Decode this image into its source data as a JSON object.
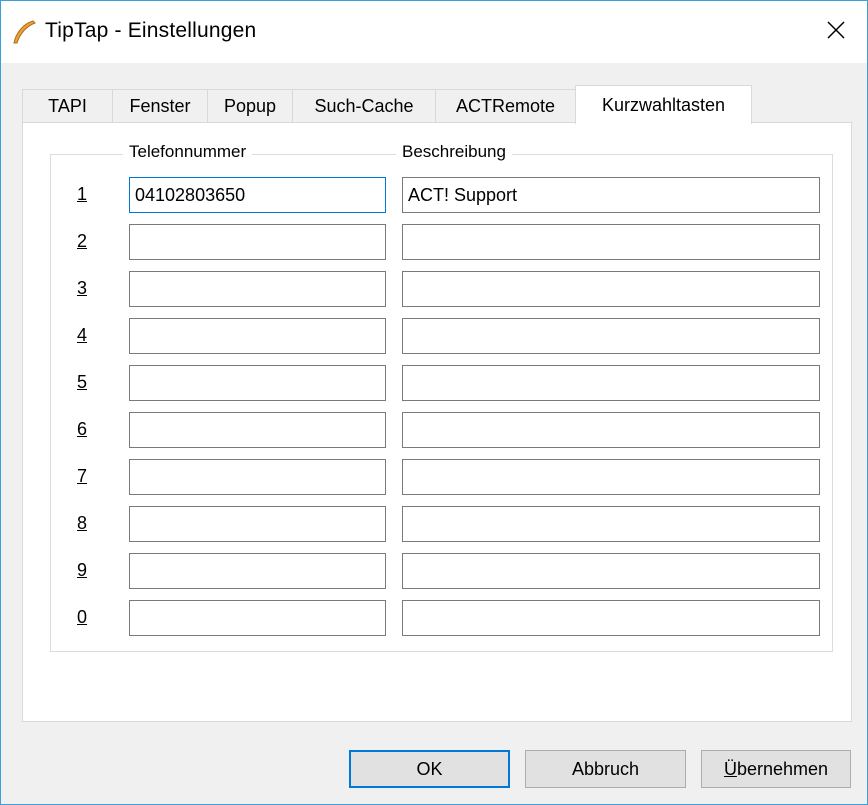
{
  "window": {
    "title": "TipTap - Einstellungen"
  },
  "tabs": [
    {
      "label": "TAPI",
      "active": false
    },
    {
      "label": "Fenster",
      "active": false
    },
    {
      "label": "Popup",
      "active": false
    },
    {
      "label": "Such-Cache",
      "active": false
    },
    {
      "label": "ACTRemote",
      "active": false
    },
    {
      "label": "Kurzwahltasten",
      "active": true
    }
  ],
  "speed_dial": {
    "phone_header": "Telefonnummer",
    "description_header": "Beschreibung",
    "rows": [
      {
        "key": "1",
        "phone": "04102803650",
        "description": "ACT! Support"
      },
      {
        "key": "2",
        "phone": "",
        "description": ""
      },
      {
        "key": "3",
        "phone": "",
        "description": ""
      },
      {
        "key": "4",
        "phone": "",
        "description": ""
      },
      {
        "key": "5",
        "phone": "",
        "description": ""
      },
      {
        "key": "6",
        "phone": "",
        "description": ""
      },
      {
        "key": "7",
        "phone": "",
        "description": ""
      },
      {
        "key": "8",
        "phone": "",
        "description": ""
      },
      {
        "key": "9",
        "phone": "",
        "description": ""
      },
      {
        "key": "0",
        "phone": "",
        "description": ""
      }
    ]
  },
  "buttons": {
    "ok": "OK",
    "cancel": "Abbruch",
    "apply_mnemonic": "Ü",
    "apply_rest": "bernehmen"
  },
  "colors": {
    "accent": "#0078d7",
    "window_border": "#3b9fd9",
    "icon": "#e8a33d"
  }
}
